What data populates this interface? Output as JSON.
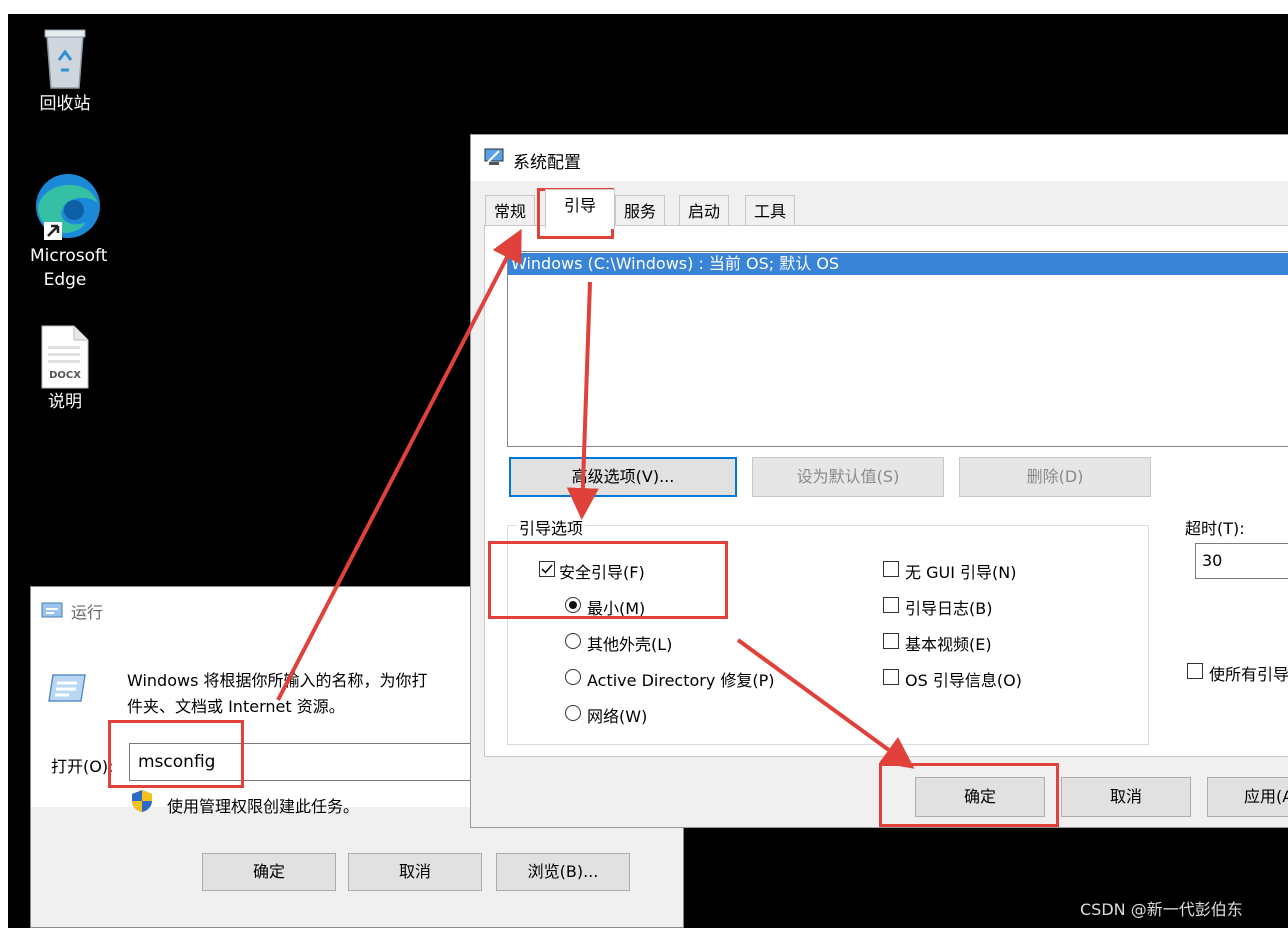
{
  "desktop": {
    "icons": [
      {
        "label": "回收站"
      },
      {
        "label": "Microsoft Edge"
      },
      {
        "label": "说明",
        "badge": "DOCX"
      }
    ],
    "watermark": "CSDN @新一代彭伯东"
  },
  "run_dialog": {
    "title": "运行",
    "description_line1": "Windows 将根据你所输入的名称，为你打",
    "description_line2": "件夹、文档或 Internet 资源。",
    "open_label": "打开(O):",
    "open_value": "msconfig",
    "admin_note": "使用管理权限创建此任务。",
    "buttons": {
      "ok": "确定",
      "cancel": "取消",
      "browse": "浏览(B)..."
    }
  },
  "msconfig": {
    "title": "系统配置",
    "tabs": [
      "常规",
      "引导",
      "服务",
      "启动",
      "工具"
    ],
    "active_tab": "引导",
    "boot_entry": "Windows (C:\\Windows) : 当前 OS; 默认 OS",
    "buttons": {
      "advanced": "高级选项(V)...",
      "set_default": "设为默认值(S)",
      "delete": "删除(D)",
      "ok": "确定",
      "cancel": "取消",
      "apply": "应用(A"
    },
    "boot_options_title": "引导选项",
    "safe_boot": {
      "label": "安全引导(F)",
      "checked": true
    },
    "safe_modes": [
      {
        "label": "最小(M)",
        "selected": true
      },
      {
        "label": "其他外壳(L)",
        "selected": false
      },
      {
        "label": "Active Directory 修复(P)",
        "selected": false
      },
      {
        "label": "网络(W)",
        "selected": false
      }
    ],
    "right_options": [
      {
        "label": "无 GUI 引导(N)",
        "checked": false
      },
      {
        "label": "引导日志(B)",
        "checked": false
      },
      {
        "label": "基本视频(E)",
        "checked": false
      },
      {
        "label": "OS 引导信息(O)",
        "checked": false
      }
    ],
    "timeout_label": "超时(T):",
    "timeout_value": "30",
    "make_permanent": "使所有引导"
  },
  "colors": {
    "annotation_red": "#e0413a",
    "selection_blue": "#3a84d8",
    "focus_blue": "#0078d7"
  }
}
